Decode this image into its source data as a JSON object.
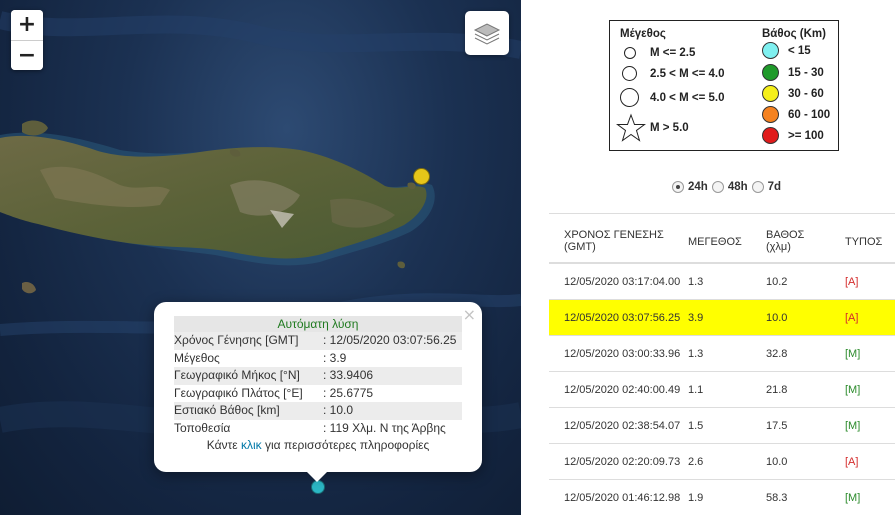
{
  "map": {
    "zoom_in": "+",
    "zoom_out": "−",
    "layers_icon": "layers-icon",
    "popup": {
      "close": "×",
      "title": "Αυτόματη λύση",
      "rows": [
        {
          "label": "Χρόνος Γένησης [GMT]",
          "value": ": 12/05/2020 03:07:56.25"
        },
        {
          "label": "Μέγεθος",
          "value": ": 3.9"
        },
        {
          "label": "Γεωγραφικό Μήκος [°N]",
          "value": ": 33.9406"
        },
        {
          "label": "Γεωγραφικό Πλάτος [°E]",
          "value": ": 25.6775"
        },
        {
          "label": "Εστιακό Βάθος [km]",
          "value": ": 10.0"
        },
        {
          "label": "Τοποθεσία",
          "value": ": 119 Χλμ. Ν της Άρβης"
        }
      ],
      "more_prefix": "Κάντε ",
      "more_link": "κλικ",
      "more_suffix": " για περισσότερες πληροφορίες"
    },
    "colors": {
      "marker_yellow": "#e6c619",
      "marker_cyan": "#2bb7c4"
    }
  },
  "legend": {
    "magnitude_header": "Μέγεθος",
    "depth_header": "Βάθος (Km)",
    "magnitude_items": [
      "M <= 2.5",
      "2.5 < M <= 4.0",
      "4.0 < M <= 5.0",
      "M > 5.0"
    ],
    "depth_items": [
      {
        "label": "< 15",
        "color": "#7ff0f0"
      },
      {
        "label": "15 - 30",
        "color": "#1f9a2a"
      },
      {
        "label": "30 - 60",
        "color": "#f5ef1a"
      },
      {
        "label": "60 - 100",
        "color": "#f58220"
      },
      {
        "label": ">= 100",
        "color": "#e01b1b"
      }
    ]
  },
  "period": {
    "options": [
      "24h",
      "48h",
      "7d"
    ],
    "selected": "24h"
  },
  "table": {
    "headers": {
      "time": "ΧΡΟΝΟΣ ΓΕΝΕΣΗΣ",
      "time_sub": "(GMT)",
      "magnitude": "ΜΕΓΕΘΟΣ",
      "depth": "ΒΑΘΟΣ",
      "depth_sub": "(χλμ)",
      "type": "ΤΥΠΟΣ"
    },
    "rows": [
      {
        "time": "12/05/2020 03:17:04.00",
        "mag": "1.3",
        "depth": "10.2",
        "type": "[A]"
      },
      {
        "time": "12/05/2020 03:07:56.25",
        "mag": "3.9",
        "depth": "10.0",
        "type": "[A]",
        "highlight": true
      },
      {
        "time": "12/05/2020 03:00:33.96",
        "mag": "1.3",
        "depth": "32.8",
        "type": "[M]"
      },
      {
        "time": "12/05/2020 02:40:00.49",
        "mag": "1.1",
        "depth": "21.8",
        "type": "[M]"
      },
      {
        "time": "12/05/2020 02:38:54.07",
        "mag": "1.5",
        "depth": "17.5",
        "type": "[M]"
      },
      {
        "time": "12/05/2020 02:20:09.73",
        "mag": "2.6",
        "depth": "10.0",
        "type": "[A]"
      },
      {
        "time": "12/05/2020 01:46:12.98",
        "mag": "1.9",
        "depth": "58.3",
        "type": "[M]"
      }
    ]
  }
}
